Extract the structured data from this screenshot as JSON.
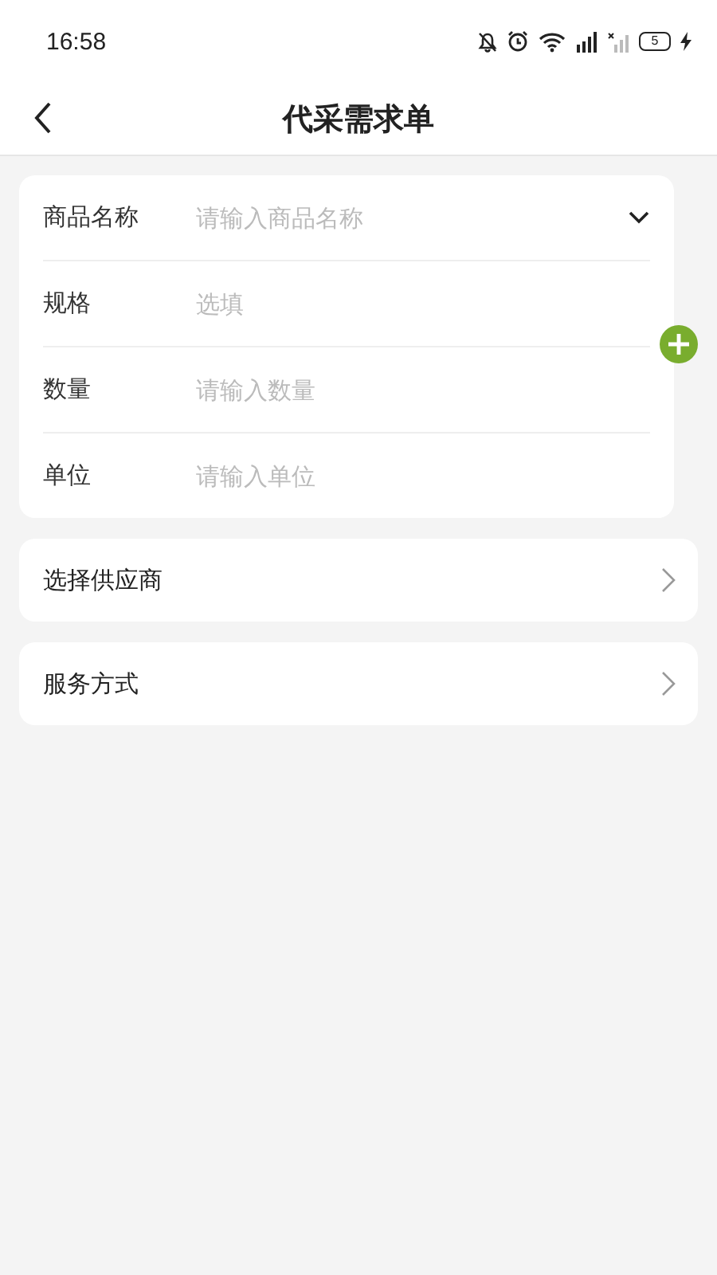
{
  "status_bar": {
    "time": "16:58",
    "battery": "5"
  },
  "header": {
    "title": "代采需求单"
  },
  "form": {
    "fields": [
      {
        "label": "商品名称",
        "placeholder": "请输入商品名称",
        "kind": "dropdown"
      },
      {
        "label": "规格",
        "placeholder": "选填",
        "kind": "input"
      },
      {
        "label": "数量",
        "placeholder": "请输入数量",
        "kind": "input"
      },
      {
        "label": "单位",
        "placeholder": "请输入单位",
        "kind": "input"
      }
    ]
  },
  "links": [
    {
      "label": "选择供应商"
    },
    {
      "label": "服务方式"
    }
  ]
}
